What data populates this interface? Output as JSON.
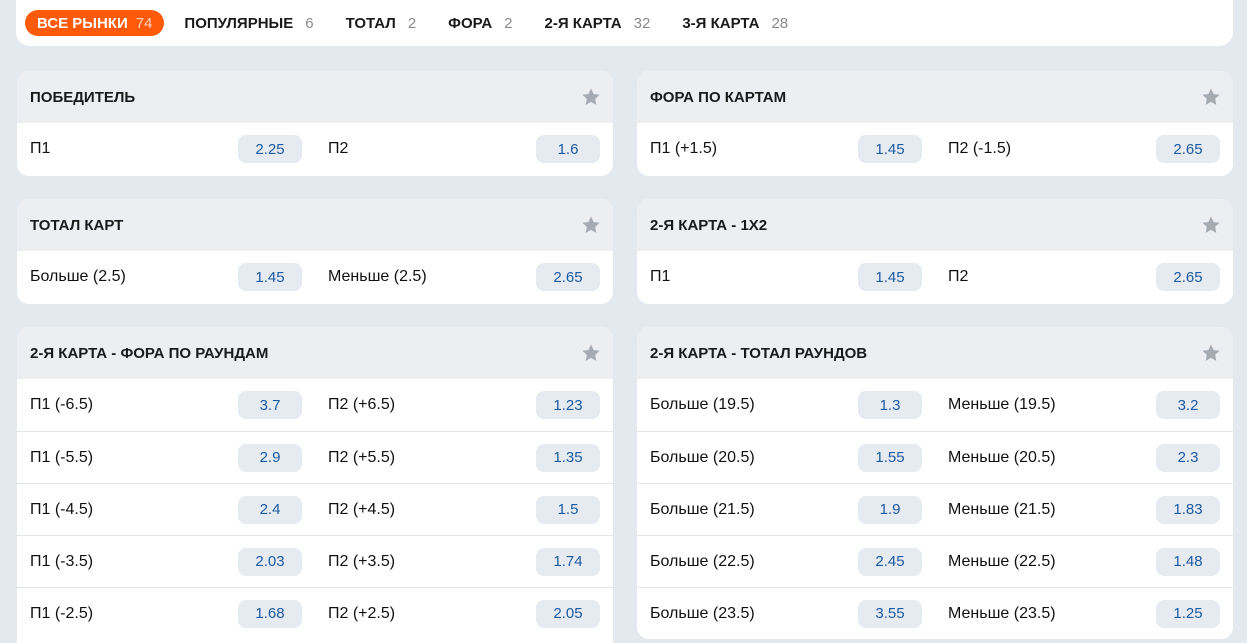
{
  "tabs": [
    {
      "label": "ВСЕ РЫНКИ",
      "count": "74",
      "active": true
    },
    {
      "label": "ПОПУЛЯРНЫЕ",
      "count": "6"
    },
    {
      "label": "ТОТАЛ",
      "count": "2"
    },
    {
      "label": "ФОРА",
      "count": "2"
    },
    {
      "label": "2-Я КАРТА",
      "count": "32"
    },
    {
      "label": "3-Я КАРТА",
      "count": "28"
    }
  ],
  "panels": [
    {
      "title": "ПОБЕДИТЕЛЬ",
      "rows": [
        [
          {
            "label": "П1",
            "odd": "2.25"
          },
          {
            "label": "П2",
            "odd": "1.6"
          }
        ]
      ]
    },
    {
      "title": "ФОРА ПО КАРТАМ",
      "rows": [
        [
          {
            "label": "П1 (+1.5)",
            "odd": "1.45"
          },
          {
            "label": "П2 (-1.5)",
            "odd": "2.65"
          }
        ]
      ]
    },
    {
      "title": "ТОТАЛ КАРТ",
      "rows": [
        [
          {
            "label": "Больше (2.5)",
            "odd": "1.45"
          },
          {
            "label": "Меньше (2.5)",
            "odd": "2.65"
          }
        ]
      ]
    },
    {
      "title": "2-Я КАРТА - 1Х2",
      "rows": [
        [
          {
            "label": "П1",
            "odd": "1.45"
          },
          {
            "label": "П2",
            "odd": "2.65"
          }
        ]
      ]
    },
    {
      "title": "2-Я КАРТА - ФОРА ПО РАУНДАМ",
      "rows": [
        [
          {
            "label": "П1 (-6.5)",
            "odd": "3.7"
          },
          {
            "label": "П2 (+6.5)",
            "odd": "1.23"
          }
        ],
        [
          {
            "label": "П1 (-5.5)",
            "odd": "2.9"
          },
          {
            "label": "П2 (+5.5)",
            "odd": "1.35"
          }
        ],
        [
          {
            "label": "П1 (-4.5)",
            "odd": "2.4"
          },
          {
            "label": "П2 (+4.5)",
            "odd": "1.5"
          }
        ],
        [
          {
            "label": "П1 (-3.5)",
            "odd": "2.03"
          },
          {
            "label": "П2 (+3.5)",
            "odd": "1.74"
          }
        ],
        [
          {
            "label": "П1 (-2.5)",
            "odd": "1.68"
          },
          {
            "label": "П2 (+2.5)",
            "odd": "2.05"
          }
        ]
      ]
    },
    {
      "title": "2-Я КАРТА - ТОТАЛ РАУНДОВ",
      "rows": [
        [
          {
            "label": "Больше (19.5)",
            "odd": "1.3"
          },
          {
            "label": "Меньше (19.5)",
            "odd": "3.2"
          }
        ],
        [
          {
            "label": "Больше (20.5)",
            "odd": "1.55"
          },
          {
            "label": "Меньше (20.5)",
            "odd": "2.3"
          }
        ],
        [
          {
            "label": "Больше (21.5)",
            "odd": "1.9"
          },
          {
            "label": "Меньше (21.5)",
            "odd": "1.83"
          }
        ],
        [
          {
            "label": "Больше (22.5)",
            "odd": "2.45"
          },
          {
            "label": "Меньше (22.5)",
            "odd": "1.48"
          }
        ],
        [
          {
            "label": "Больше (23.5)",
            "odd": "3.55"
          },
          {
            "label": "Меньше (23.5)",
            "odd": "1.25"
          }
        ]
      ]
    }
  ],
  "icons": {
    "favorite": "star-icon"
  },
  "colors": {
    "accent": "#ff5a0a",
    "odd_text": "#1c5aa1",
    "odd_bg": "#e6ebf1"
  }
}
